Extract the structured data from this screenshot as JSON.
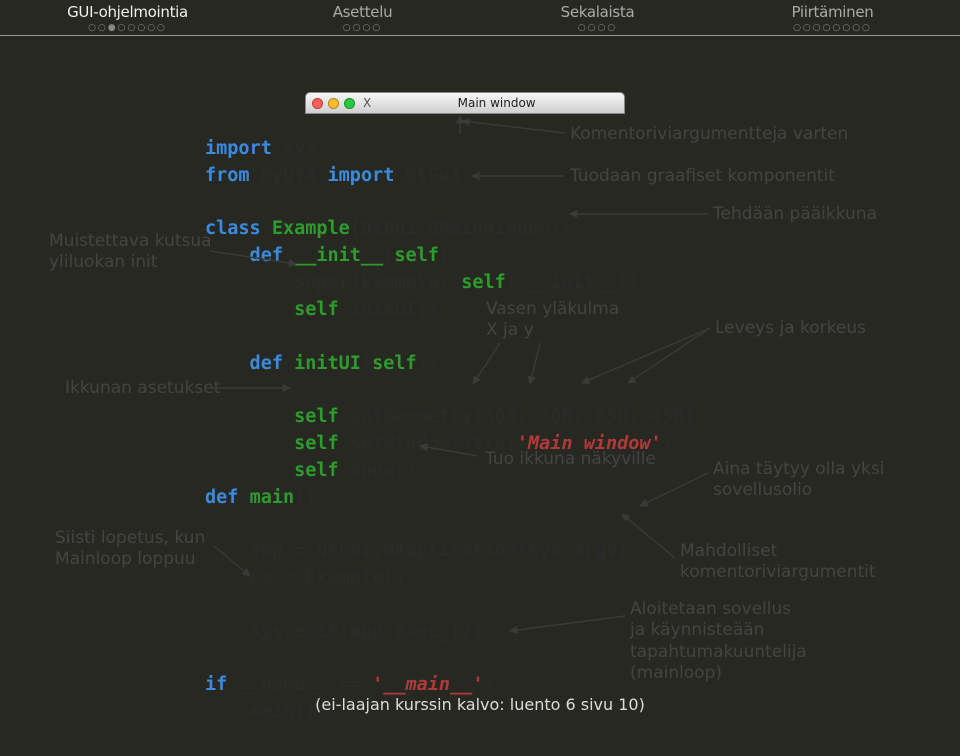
{
  "nav": {
    "items": [
      {
        "title": "GUI-ohjelmointia",
        "dots": "○○●○○○○○",
        "active": true
      },
      {
        "title": "Asettelu",
        "dots": "○○○○",
        "active": false
      },
      {
        "title": "Sekalaista",
        "dots": "○○○○",
        "active": false
      },
      {
        "title": "Piirtäminen",
        "dots": "○○○○○○○○",
        "active": false
      }
    ]
  },
  "window": {
    "title": "Main window",
    "icon_label": "X"
  },
  "code": {
    "l1a": "import ",
    "l1b": "sys",
    "l2a": "from ",
    "l2b": "PyQt4 ",
    "l2c": "import ",
    "l2d": "QtGui",
    "l3a": "class ",
    "l3b": "Example",
    "l3c": "(QtGui.QMainWindow):",
    "l4a": "    def ",
    "l4b": "__init__",
    "l4c": "(",
    "l4d": "self",
    "l4e": "):",
    "l5a": "        super",
    "l5b": "(Example, ",
    "l5c": "self",
    "l5d": ").__init__()",
    "l6a": "        ",
    "l6b": "self",
    "l6c": ".initUI()",
    "l7": "",
    "l8a": "    def ",
    "l8b": "initUI",
    "l8c": "(",
    "l8d": "self",
    "l8e": "):",
    "l9": "",
    "l10a": "        ",
    "l10b": "self",
    "l10c": ".setGeometry(",
    "l10d": "300",
    "l10e": ", ",
    "l10f": "300",
    "l10g": ", ",
    "l10h": "650",
    "l10i": ", ",
    "l10j": "450",
    "l10k": ")",
    "l11a": "        ",
    "l11b": "self",
    "l11c": ".setWindowTitle(",
    "l11d": "'Main window'",
    "l11e": ")",
    "l12a": "        ",
    "l12b": "self",
    "l12c": ".show()",
    "l13a": "def ",
    "l13b": "main",
    "l13c": "():",
    "l14": "",
    "l15a": "    app = QtGui.QApplication(sys.argv)",
    "l16a": "    ex = Example()",
    "l17": "",
    "l18a": "    sys.exit(app.exec_())",
    "l19": "",
    "l20a": "if ",
    "l20b": "__name__ == ",
    "l20c": "'__main__'",
    "l20d": ":",
    "l21a": "    main()"
  },
  "ann": {
    "a1": "Komentoriviargumentteja varten",
    "a2": "Tuodaan graafiset komponentit",
    "a3": "Tehdään pääikkuna",
    "a4": "Muistettava kutsua\nyliluokan init",
    "a5": "Vasen yläkulma\nX ja y",
    "a6": "Leveys ja korkeus",
    "a7": "Ikkunan asetukset",
    "a8": "Tuo ikkuna näkyville",
    "a9": "Aina täytyy olla yksi\nsovellusolio",
    "a10": "Siisti lopetus, kun\nMainloop loppuu",
    "a11": "Mahdolliset\nkomentoriviargumentit",
    "a12": "Aloitetaan sovellus\nja käynnisteään\ntapahtumakuuntelija\n(mainloop)"
  },
  "footer": "(ei-laajan kurssin kalvo: luento 6 sivu 10)"
}
